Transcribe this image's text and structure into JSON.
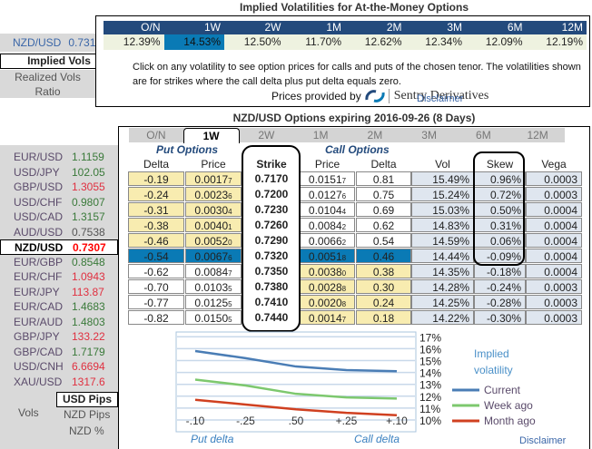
{
  "atm": {
    "title": "Implied Volatilities for At-the-Money Options",
    "pair": "NZD/USD",
    "rate": "0.7310",
    "tenors": [
      "O/N",
      "1W",
      "2W",
      "1M",
      "2M",
      "3M",
      "6M",
      "12M"
    ],
    "vols": [
      "12.39%",
      "14.53%",
      "12.50%",
      "11.70%",
      "12.62%",
      "12.34%",
      "12.09%",
      "12.19%"
    ],
    "selected": 1,
    "note": "Click on any volatility to see option prices for calls and puts of the chosen tenor. The volatilities shown are for strikes where the call delta plus put delta equals zero.",
    "provided_by": "Prices provided by",
    "brand": "Sentry Derivatives",
    "disclaimer": "Disclaimer"
  },
  "modes": {
    "implied": "Implied Vols",
    "realized": "Realized Vols",
    "ratio": "Ratio"
  },
  "options": {
    "title": "NZD/USD Options expiring 2016-09-26 (8 Days)",
    "tabs": [
      "O/N",
      "1W",
      "2W",
      "1M",
      "2M",
      "3M",
      "6M",
      "12M"
    ],
    "selected_tab": 1,
    "put_header": "Put Options",
    "call_header": "Call Options",
    "columns": [
      "Delta",
      "Price",
      "Strike",
      "Price",
      "Delta",
      "Vol",
      "Skew",
      "Vega"
    ],
    "rows": [
      [
        "-0.19",
        "0.0017",
        "7",
        "0.7170",
        "0.0151",
        "7",
        "0.81",
        "15.49%",
        "0.96%",
        "0.0003"
      ],
      [
        "-0.24",
        "0.0023",
        "6",
        "0.7200",
        "0.0127",
        "6",
        "0.75",
        "15.24%",
        "0.72%",
        "0.0003"
      ],
      [
        "-0.31",
        "0.0030",
        "4",
        "0.7230",
        "0.0104",
        "4",
        "0.69",
        "15.03%",
        "0.50%",
        "0.0004"
      ],
      [
        "-0.38",
        "0.0040",
        "1",
        "0.7260",
        "0.0084",
        "2",
        "0.62",
        "14.83%",
        "0.31%",
        "0.0004"
      ],
      [
        "-0.46",
        "0.0052",
        "0",
        "0.7290",
        "0.0066",
        "2",
        "0.54",
        "14.59%",
        "0.06%",
        "0.0004"
      ],
      [
        "-0.54",
        "0.0067",
        "6",
        "0.7320",
        "0.0051",
        "8",
        "0.46",
        "14.44%",
        "-0.09%",
        "0.0004"
      ],
      [
        "-0.62",
        "0.0084",
        "7",
        "0.7350",
        "0.0038",
        "0",
        "0.38",
        "14.35%",
        "-0.18%",
        "0.0004"
      ],
      [
        "-0.70",
        "0.0103",
        "5",
        "0.7380",
        "0.0028",
        "8",
        "0.30",
        "14.28%",
        "-0.24%",
        "0.0003"
      ],
      [
        "-0.77",
        "0.0125",
        "5",
        "0.7410",
        "0.0020",
        "8",
        "0.24",
        "14.25%",
        "-0.28%",
        "0.0003"
      ],
      [
        "-0.82",
        "0.0150",
        "5",
        "0.7440",
        "0.0014",
        "7",
        "0.18",
        "14.22%",
        "-0.30%",
        "0.0003"
      ]
    ],
    "atm_row": 5,
    "disclaimer": "Disclaimer"
  },
  "currencies": [
    {
      "pair": "EUR/USD",
      "rate": "1.1159",
      "color": "#3a7a3a"
    },
    {
      "pair": "USD/JPY",
      "rate": "102.05",
      "color": "#3a7a3a"
    },
    {
      "pair": "GBP/USD",
      "rate": "1.3055",
      "color": "#e03040"
    },
    {
      "pair": "USD/CHF",
      "rate": "0.9807",
      "color": "#3a7a3a"
    },
    {
      "pair": "USD/CAD",
      "rate": "1.3157",
      "color": "#3a7a3a"
    },
    {
      "pair": "AUD/USD",
      "rate": "0.7538",
      "color": "#555555"
    },
    {
      "pair": "NZD/USD",
      "rate": "0.7307",
      "color": "#ff0000",
      "selected": true
    },
    {
      "pair": "EUR/GBP",
      "rate": "0.8548",
      "color": "#3a7a3a"
    },
    {
      "pair": "EUR/CHF",
      "rate": "1.0943",
      "color": "#e03040"
    },
    {
      "pair": "EUR/JPY",
      "rate": "113.87",
      "color": "#e03040"
    },
    {
      "pair": "EUR/CAD",
      "rate": "1.4683",
      "color": "#3a7a3a"
    },
    {
      "pair": "EUR/AUD",
      "rate": "1.4803",
      "color": "#3a7a3a"
    },
    {
      "pair": "GBP/JPY",
      "rate": "133.22",
      "color": "#e03040"
    },
    {
      "pair": "GBP/CAD",
      "rate": "1.7179",
      "color": "#3a7a3a"
    },
    {
      "pair": "USD/CNH",
      "rate": "6.6694",
      "color": "#e03040"
    },
    {
      "pair": "XAU/USD",
      "rate": "1317.6",
      "color": "#e03040"
    }
  ],
  "units": {
    "vols_label": "Vols",
    "options": [
      "USD Pips",
      "NZD Pips",
      "NZD %"
    ],
    "selected": 0
  },
  "chart_data": {
    "type": "line",
    "title": "Implied volatility",
    "categories": [
      "-.10",
      "-.25",
      ".50",
      "+.25",
      "+.10"
    ],
    "xlabel_left": "Put delta",
    "xlabel_right": "Call delta",
    "yticks": [
      "17%",
      "16%",
      "15%",
      "14%",
      "13%",
      "12%",
      "11%",
      "10%"
    ],
    "ylim": [
      10,
      17
    ],
    "grid": true,
    "legend": "right",
    "series": [
      {
        "name": "Current",
        "color": "#4a7db5",
        "values": [
          15.8,
          15.2,
          14.5,
          14.2,
          14.1
        ]
      },
      {
        "name": "Week ago",
        "color": "#7dc86e",
        "values": [
          13.4,
          12.9,
          12.2,
          11.9,
          11.8
        ]
      },
      {
        "name": "Month ago",
        "color": "#d04020",
        "values": [
          11.7,
          11.3,
          10.9,
          10.6,
          10.4
        ]
      }
    ]
  }
}
